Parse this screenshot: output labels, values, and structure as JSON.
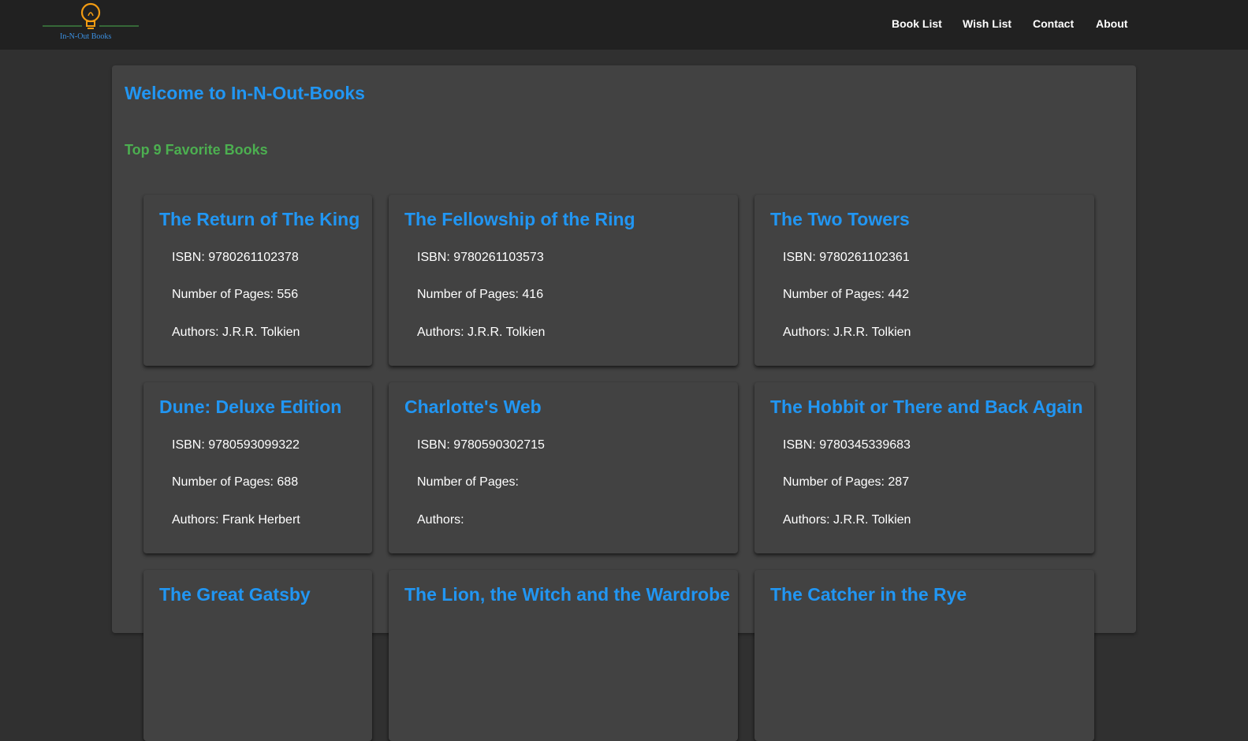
{
  "header": {
    "logo_text": "In-N-Out Books",
    "nav": [
      "Book List",
      "Wish List",
      "Contact",
      "About"
    ]
  },
  "main": {
    "welcome": "Welcome to In-N-Out-Books",
    "subtitle": "Top 9 Favorite Books",
    "labels": {
      "isbn": "ISBN: ",
      "pages": "Number of Pages: ",
      "authors": "Authors: "
    },
    "books": [
      {
        "title": "The Return of The King",
        "isbn": "9780261102378",
        "pages": "556",
        "authors": "J.R.R. Tolkien"
      },
      {
        "title": "The Fellowship of the Ring",
        "isbn": "9780261103573",
        "pages": "416",
        "authors": "J.R.R. Tolkien"
      },
      {
        "title": "The Two Towers",
        "isbn": "9780261102361",
        "pages": "442",
        "authors": "J.R.R. Tolkien"
      },
      {
        "title": "Dune: Deluxe Edition",
        "isbn": "9780593099322",
        "pages": "688",
        "authors": "Frank Herbert"
      },
      {
        "title": "Charlotte's Web",
        "isbn": "9780590302715",
        "pages": "",
        "authors": ""
      },
      {
        "title": "The Hobbit or There and Back Again",
        "isbn": "9780345339683",
        "pages": "287",
        "authors": "J.R.R. Tolkien"
      },
      {
        "title": "The Great Gatsby"
      },
      {
        "title": "The Lion, the Witch and the Wardrobe"
      },
      {
        "title": "The Catcher in the Rye"
      }
    ]
  },
  "colors": {
    "header_bg": "#212121",
    "page_bg": "#303030",
    "card_bg": "#424242",
    "title_blue": "#2196f3",
    "subtitle_green": "#4caf50",
    "logo_bulb": "#f39c12"
  }
}
